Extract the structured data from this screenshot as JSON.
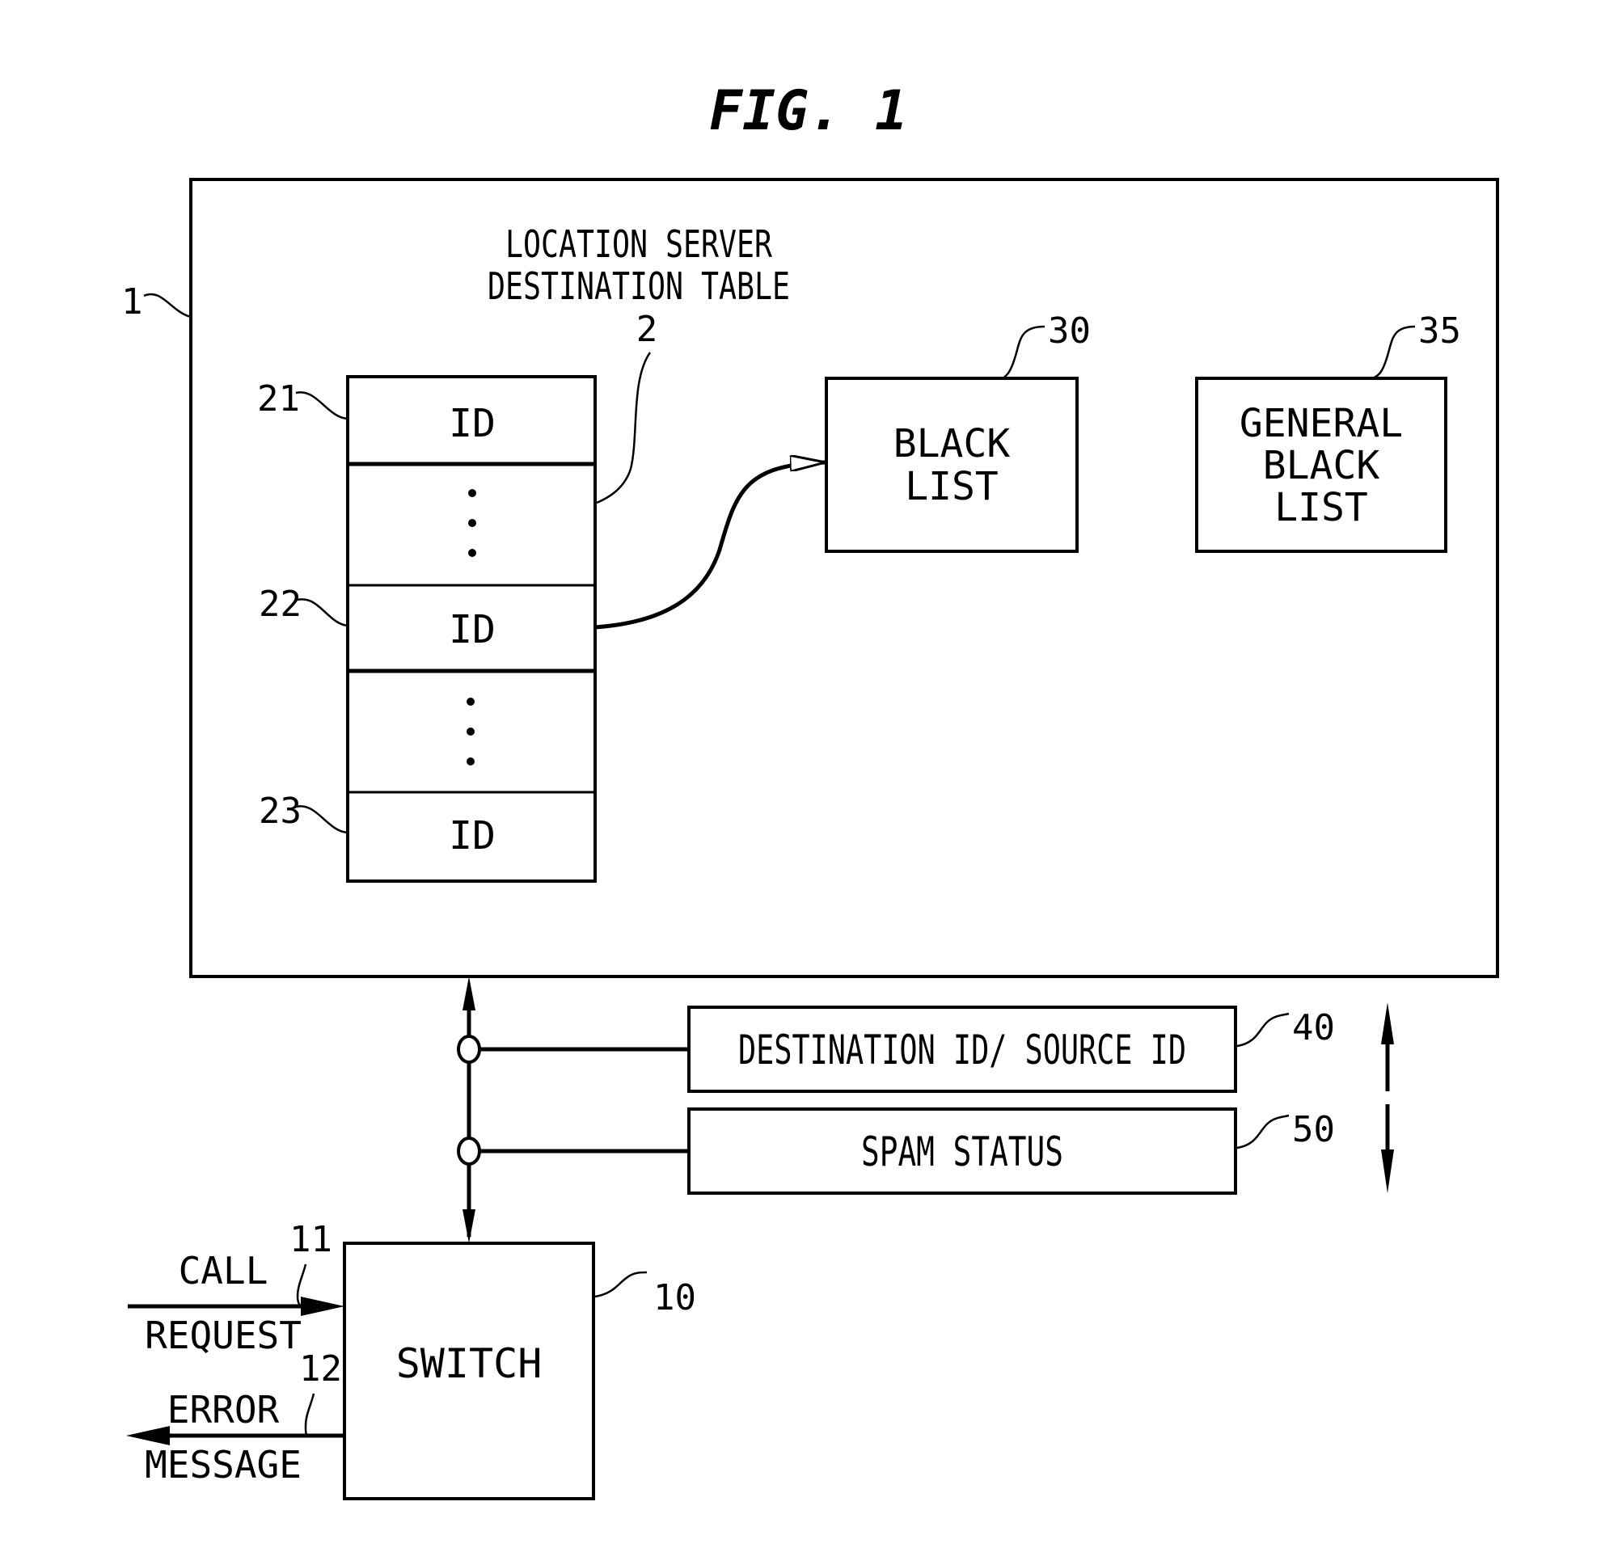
{
  "figure": {
    "title": "FIG. 1"
  },
  "location_server": {
    "ref": "1",
    "title_lines": [
      "LOCATION SERVER",
      "DESTINATION TABLE"
    ],
    "table_ref": "2",
    "rows": [
      {
        "ref": "21",
        "label": "ID"
      },
      {
        "ref": "",
        "label": "ellipsis"
      },
      {
        "ref": "22",
        "label": "ID"
      },
      {
        "ref": "",
        "label": "ellipsis"
      },
      {
        "ref": "23",
        "label": "ID"
      }
    ]
  },
  "black_list": {
    "ref": "30",
    "lines": [
      "BLACK",
      "LIST"
    ]
  },
  "general_black_list": {
    "ref": "35",
    "lines": [
      "GENERAL",
      "BLACK",
      "LIST"
    ]
  },
  "messages": [
    {
      "ref": "40",
      "label": "DESTINATION ID/ SOURCE ID",
      "direction": "up"
    },
    {
      "ref": "50",
      "label": "SPAM STATUS",
      "direction": "down"
    }
  ],
  "switch": {
    "ref": "10",
    "label": "SWITCH",
    "inputs": [
      {
        "ref": "11",
        "lines": [
          "CALL",
          "REQUEST"
        ],
        "direction": "in"
      },
      {
        "ref": "12",
        "lines": [
          "ERROR",
          "MESSAGE"
        ],
        "direction": "out"
      }
    ]
  }
}
